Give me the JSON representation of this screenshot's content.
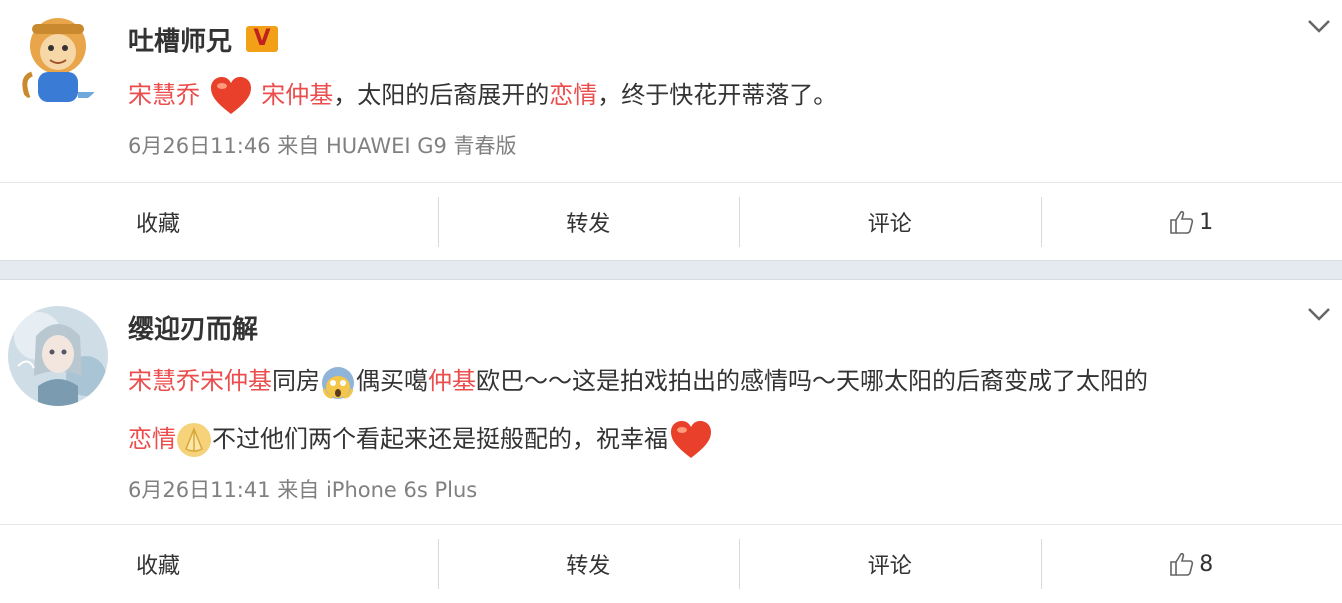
{
  "posts": [
    {
      "username": "吐槽师兄",
      "verified_badge": "V",
      "avatar": "monkey-avatar",
      "text_segments": {
        "link1": "宋慧乔",
        "link2": "宋仲基",
        "plain1": "，太阳的后裔展开的",
        "link3": "恋情",
        "plain2": "，终于快花开蒂落了。"
      },
      "emojis": [
        "heart-emoji"
      ],
      "meta": "6月26日11:46 来自 HUAWEI G9 青春版",
      "actions": {
        "favorite": "收藏",
        "repost": "转发",
        "comment": "评论",
        "like_count": "1"
      }
    },
    {
      "username": "缨迎刃而解",
      "avatar": "anime-girl-avatar",
      "text_segments": {
        "link1": "宋慧乔宋仲基",
        "plain1": "同房",
        "plain2": "偶买噶",
        "link2": "仲基",
        "plain3": "欧巴～～这是拍戏拍出的感情吗～天哪太阳的后裔变成了太阳的",
        "link3": "恋情",
        "plain4": "不过他们两个看起来还是挺般配的，祝幸福"
      },
      "emojis": [
        "scream-emoji",
        "pray-emoji",
        "heart-emoji"
      ],
      "meta": "6月26日11:41 来自 iPhone 6s Plus",
      "actions": {
        "favorite": "收藏",
        "repost": "转发",
        "comment": "评论",
        "like_count": "8"
      }
    }
  ],
  "colors": {
    "link": "#eb4d4d",
    "meta": "#808080",
    "badge": "#f2a017",
    "separator": "#e4eaf0"
  }
}
